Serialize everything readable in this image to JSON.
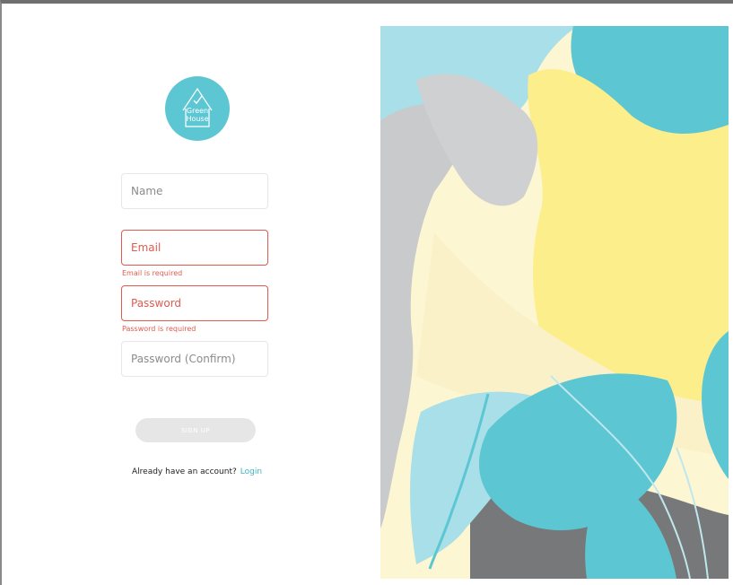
{
  "logo": {
    "line1": "Green",
    "line2": "House"
  },
  "form": {
    "name_placeholder": "Name",
    "email_placeholder": "Email",
    "email_error": "Email is required",
    "password_placeholder": "Password",
    "password_error": "Password is required",
    "confirm_placeholder": "Password (Confirm)",
    "signup_label": "SIGN UP"
  },
  "footer": {
    "prompt": "Already have an account?",
    "login_label": "Login"
  },
  "colors": {
    "accent": "#5cc7d3",
    "error": "#e05a4e",
    "button_disabled": "#e6e6e6",
    "link": "#3fb6c6"
  },
  "icons": {
    "logo": "house-check-icon"
  }
}
